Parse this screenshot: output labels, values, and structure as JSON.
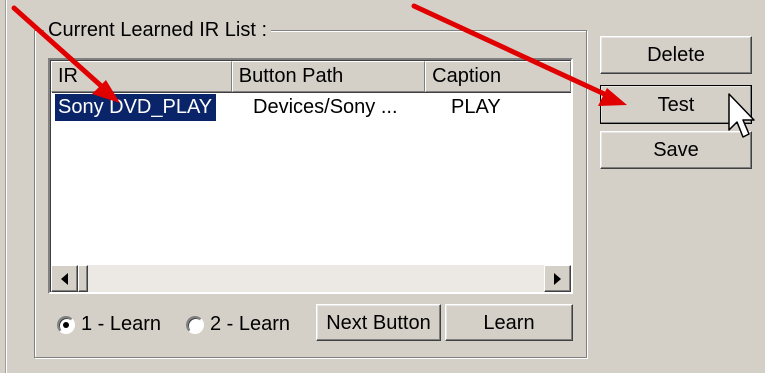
{
  "groupbox": {
    "title": "Current Learned IR List :"
  },
  "list": {
    "columns": [
      {
        "label": "IR"
      },
      {
        "label": "Button Path"
      },
      {
        "label": "Caption"
      }
    ],
    "rows": [
      {
        "ir": "Sony DVD_PLAY",
        "button_path": "Devices/Sony ...",
        "caption": "PLAY",
        "selected": true
      }
    ]
  },
  "side_buttons": {
    "delete": "Delete",
    "test": "Test",
    "save": "Save"
  },
  "bottom": {
    "radio_learn1": {
      "label": "1 - Learn",
      "checked": true
    },
    "radio_learn2": {
      "label": "2 - Learn",
      "checked": false
    },
    "next_button": "Next Button",
    "learn_button": "Learn"
  },
  "colors": {
    "window_bg": "#d4d0c8",
    "selection_bg": "#0a246a",
    "annotation_arrow": "#e00000"
  },
  "icons": {
    "scroll_left": "triangle-left",
    "scroll_right": "triangle-right",
    "cursor": "mouse-pointer-arrow"
  }
}
